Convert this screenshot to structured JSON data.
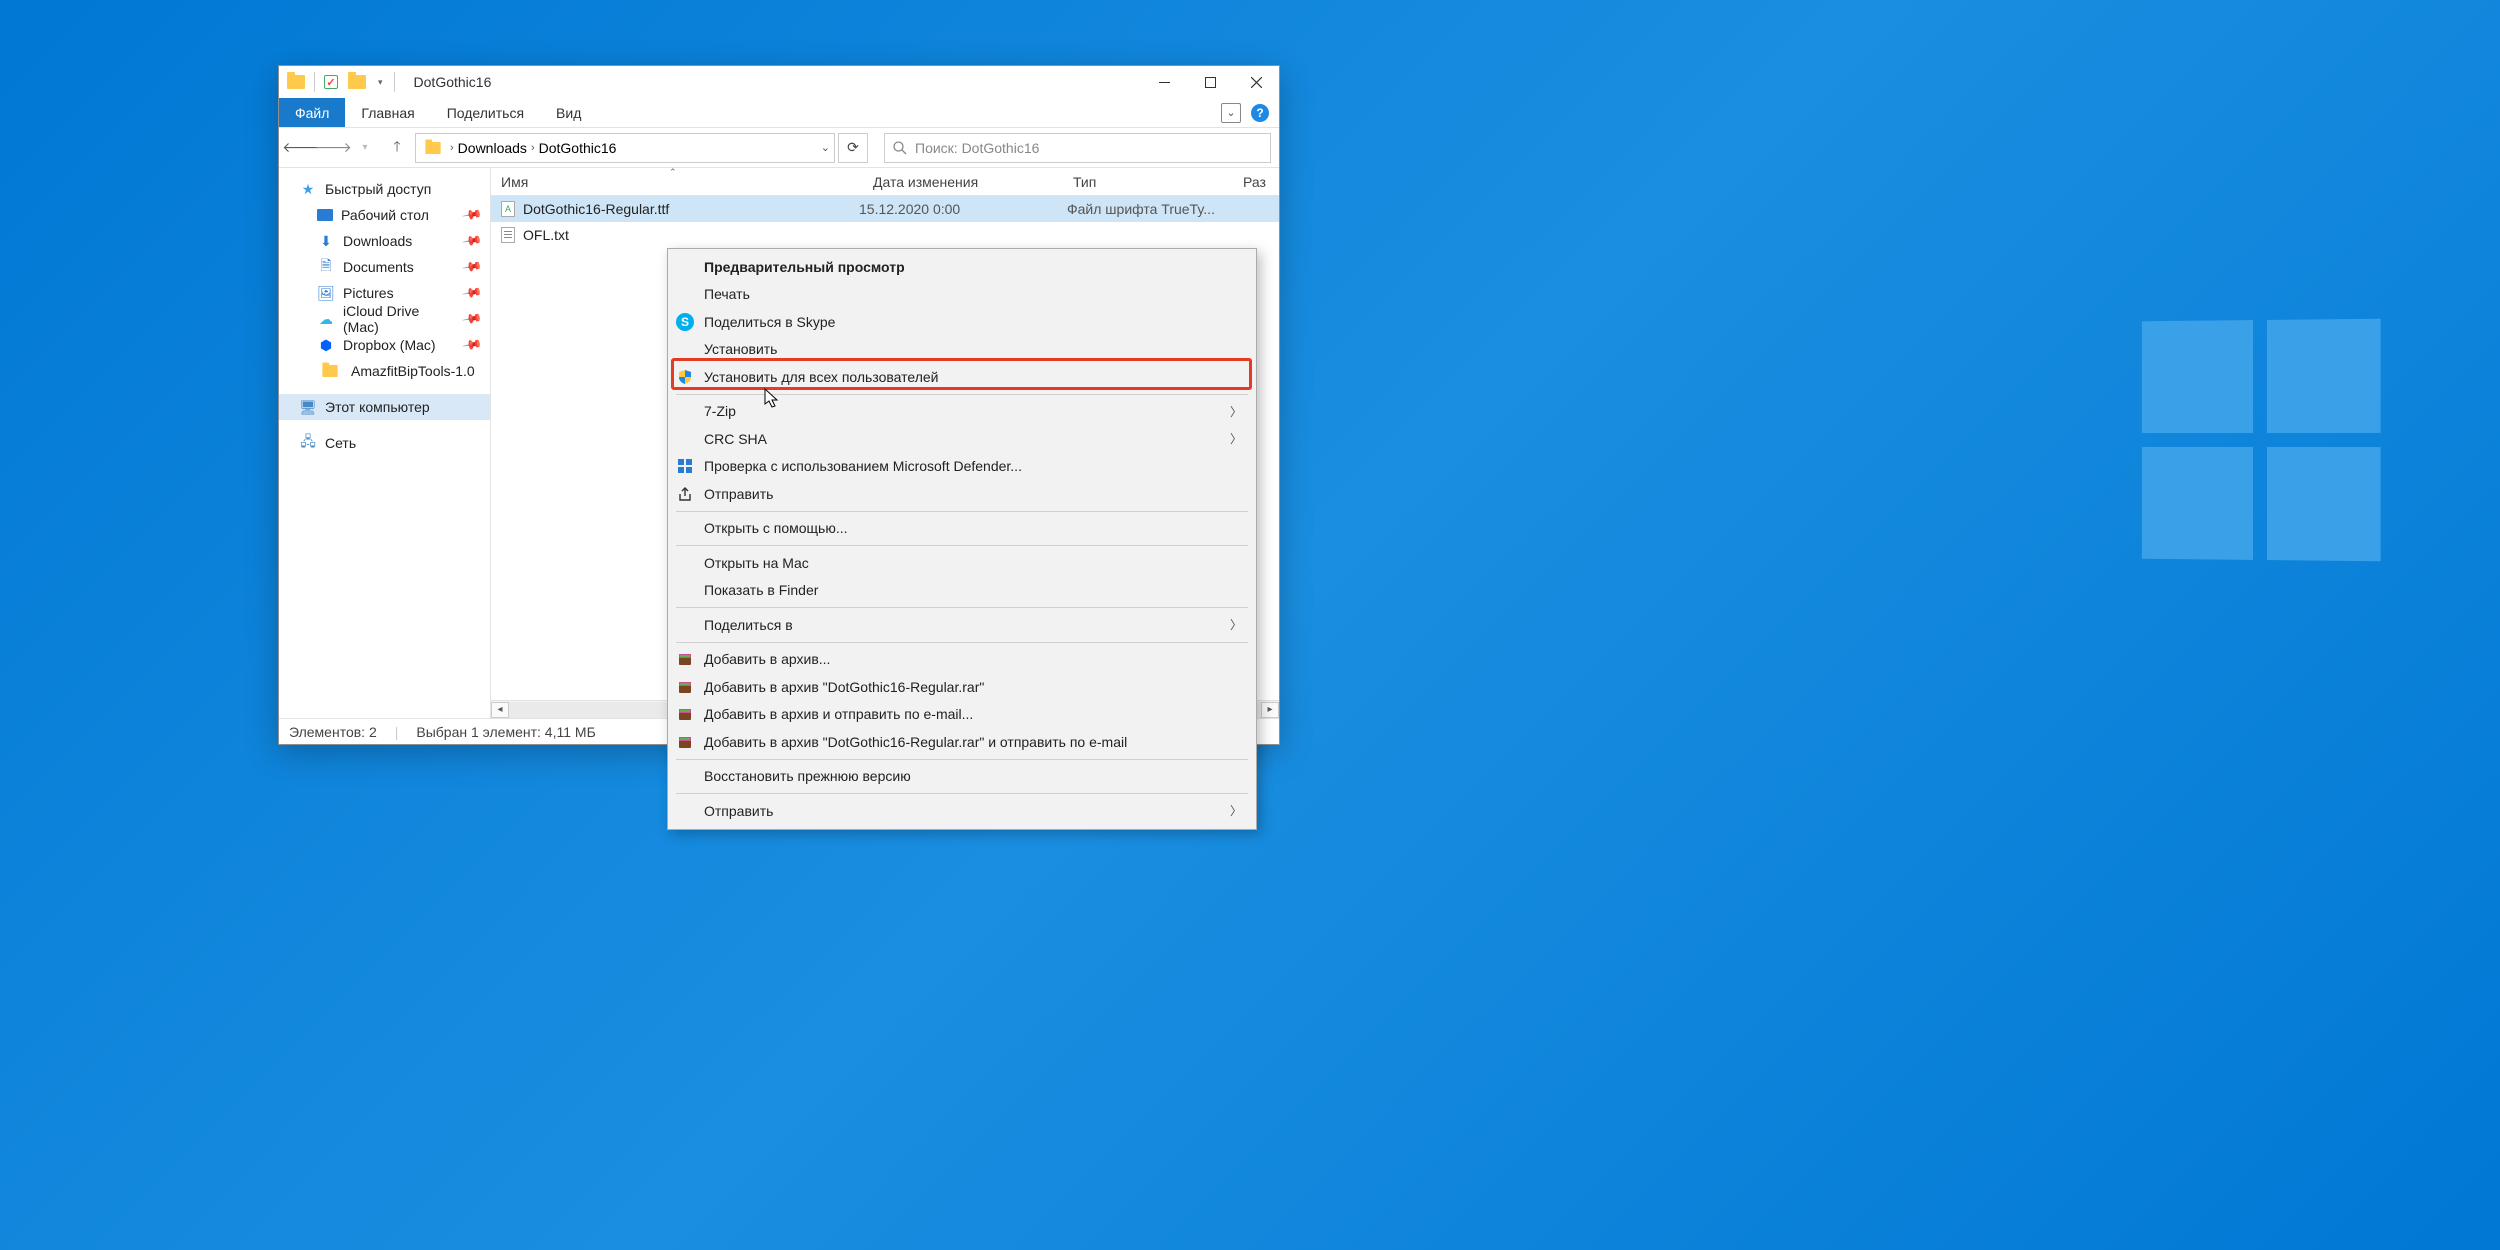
{
  "window": {
    "title": "DotGothic16"
  },
  "ribbon": {
    "tabs": [
      "Файл",
      "Главная",
      "Поделиться",
      "Вид"
    ],
    "active_index": 0
  },
  "breadcrumb": {
    "parts": [
      "Downloads",
      "DotGothic16"
    ]
  },
  "search": {
    "placeholder": "Поиск: DotGothic16"
  },
  "sidebar": {
    "quick_access": "Быстрый доступ",
    "items": [
      {
        "label": "Рабочий стол",
        "pinned": true
      },
      {
        "label": "Downloads",
        "pinned": true
      },
      {
        "label": "Documents",
        "pinned": true
      },
      {
        "label": "Pictures",
        "pinned": true
      },
      {
        "label": "iCloud Drive (Mac)",
        "pinned": true
      },
      {
        "label": "Dropbox (Mac)",
        "pinned": true
      },
      {
        "label": "AmazfitBipTools-1.0",
        "pinned": false
      }
    ],
    "this_pc": "Этот компьютер",
    "network": "Сеть"
  },
  "columns": {
    "name": "Имя",
    "date": "Дата изменения",
    "type": "Тип",
    "size": "Раз"
  },
  "files": [
    {
      "name": "DotGothic16-Regular.ttf",
      "date": "15.12.2020 0:00",
      "type": "Файл шрифта TrueTy...",
      "selected": true,
      "icon": "font"
    },
    {
      "name": "OFL.txt",
      "date": "",
      "type": "",
      "selected": false,
      "icon": "text"
    }
  ],
  "status": {
    "count": "Элементов: 2",
    "selection": "Выбран 1 элемент: 4,11 МБ"
  },
  "context_menu": [
    {
      "label": "Предварительный просмотр",
      "bold": true
    },
    {
      "label": "Печать"
    },
    {
      "label": "Поделиться в Skype",
      "icon": "skype"
    },
    {
      "label": "Установить"
    },
    {
      "label": "Установить для всех пользователей",
      "icon": "shield",
      "highlight": true
    },
    {
      "sep": true
    },
    {
      "label": "7-Zip",
      "submenu": true
    },
    {
      "label": "CRC SHA",
      "submenu": true
    },
    {
      "label": "Проверка с использованием Microsoft Defender...",
      "icon": "defender"
    },
    {
      "label": "Отправить",
      "icon": "share"
    },
    {
      "sep": true
    },
    {
      "label": "Открыть с помощью..."
    },
    {
      "sep": true
    },
    {
      "label": "Открыть на Mac"
    },
    {
      "label": "Показать в Finder"
    },
    {
      "sep": true
    },
    {
      "label": "Поделиться в",
      "submenu": true
    },
    {
      "sep": true
    },
    {
      "label": "Добавить в архив...",
      "icon": "rar"
    },
    {
      "label": "Добавить в архив \"DotGothic16-Regular.rar\"",
      "icon": "rar"
    },
    {
      "label": "Добавить в архив и отправить по e-mail...",
      "icon": "rar"
    },
    {
      "label": "Добавить в архив \"DotGothic16-Regular.rar\" и отправить по e-mail",
      "icon": "rar"
    },
    {
      "sep": true
    },
    {
      "label": "Восстановить прежнюю версию"
    },
    {
      "sep": true
    },
    {
      "label": "Отправить",
      "submenu": true
    }
  ]
}
